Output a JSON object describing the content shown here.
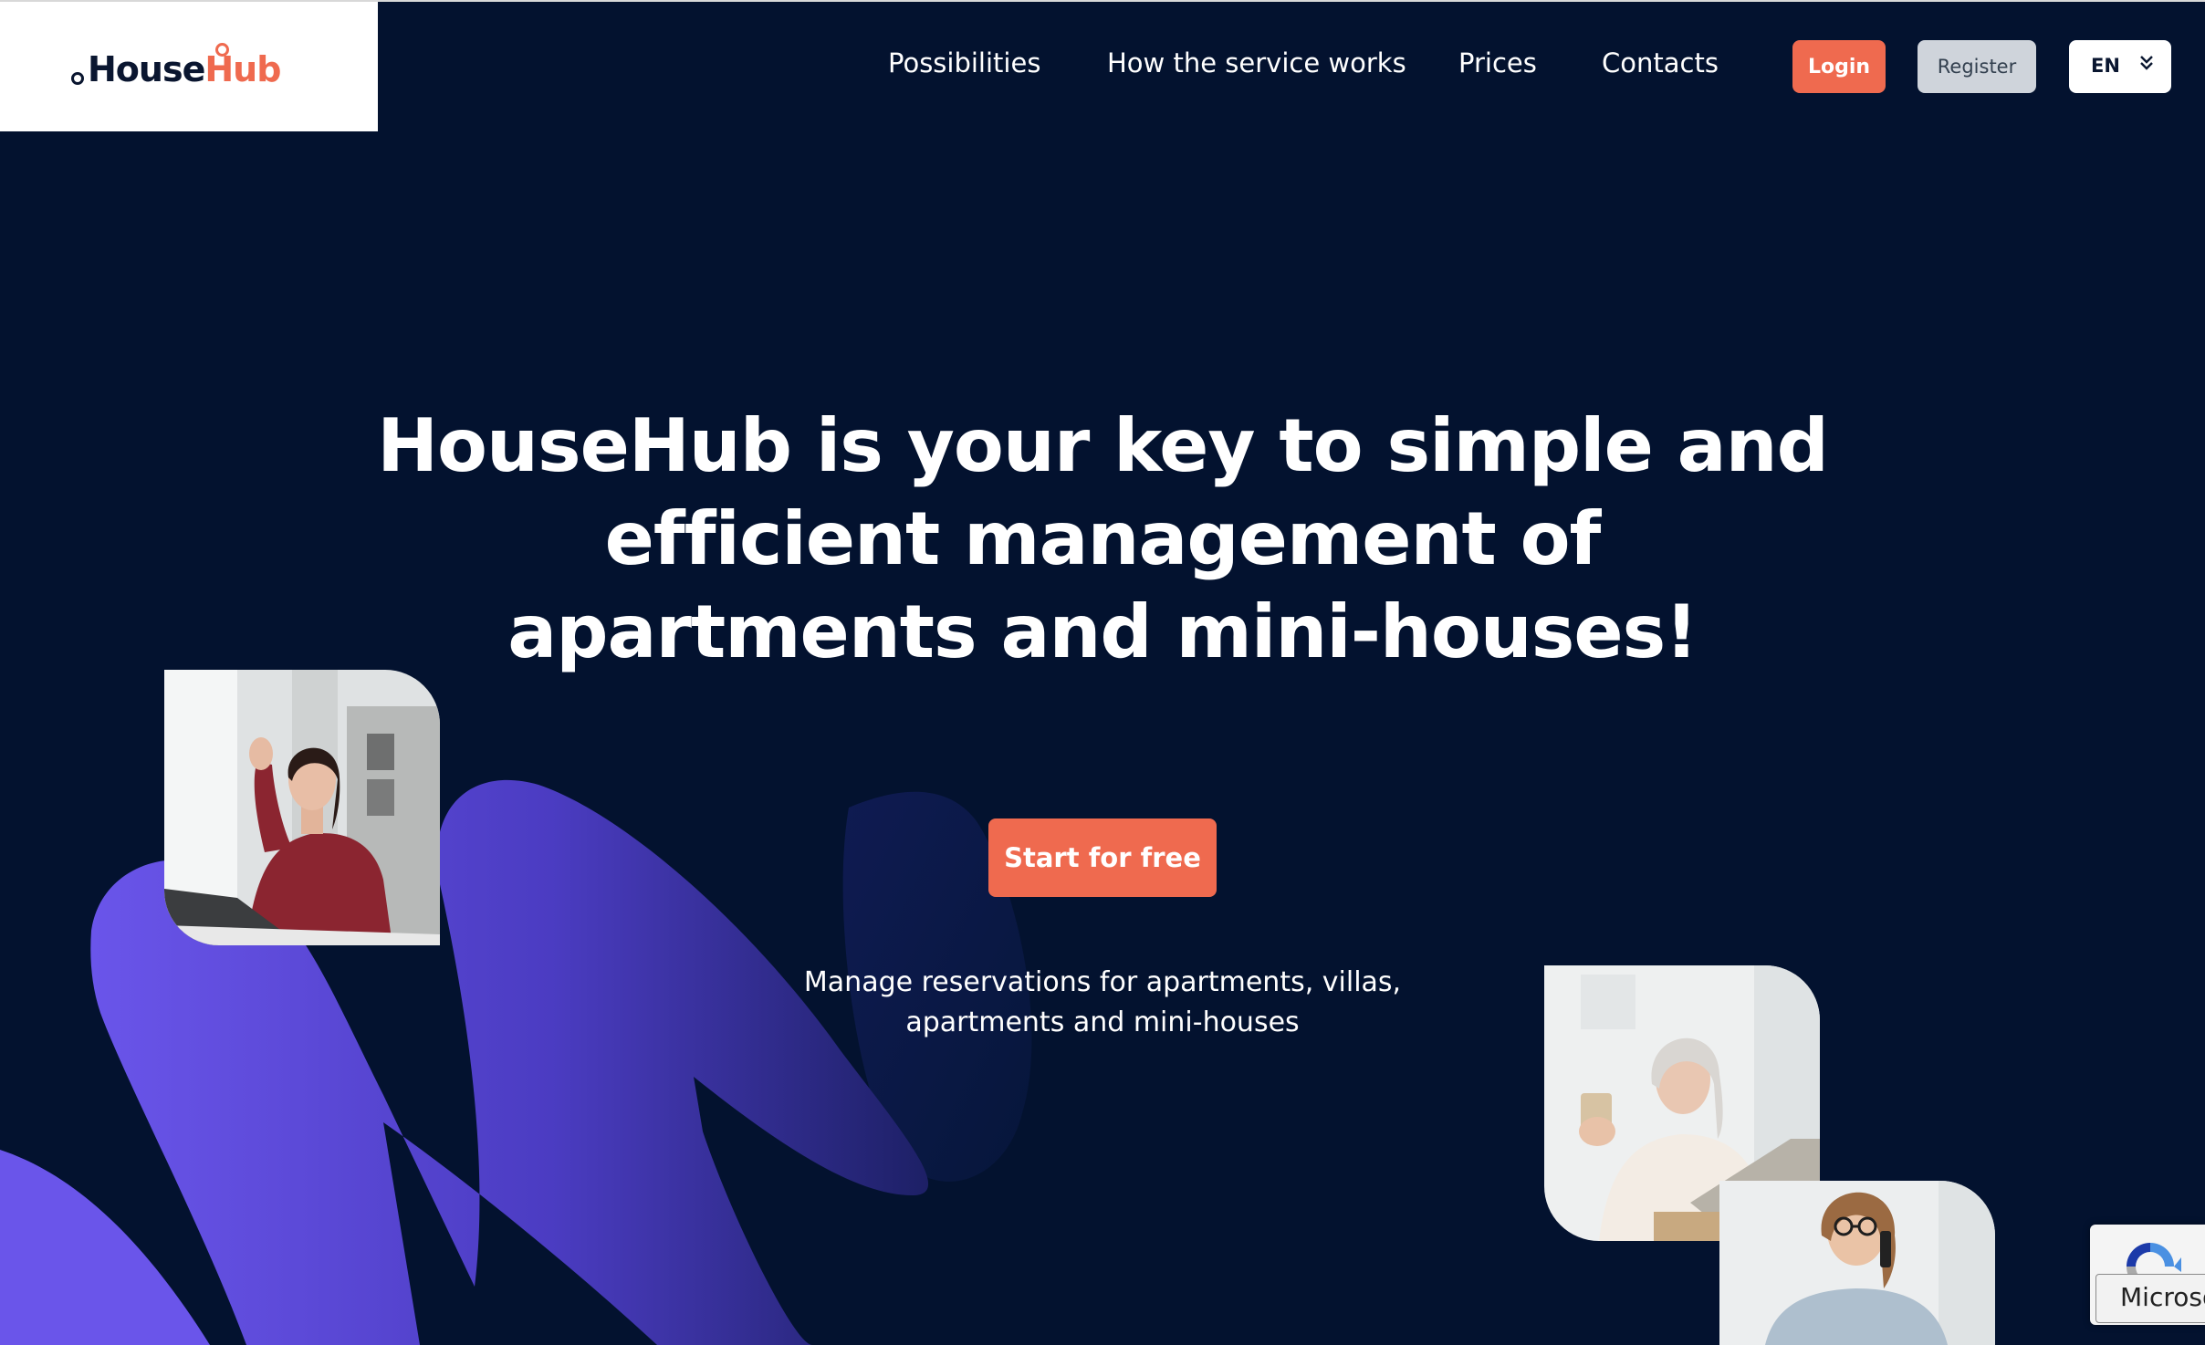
{
  "brand": {
    "name_main": "House",
    "name_accent": "Hub",
    "accent_color": "#ef6a4f",
    "background_color": "#03122f",
    "decor_color": "#6a55ea"
  },
  "nav": {
    "items": [
      {
        "label": "Possibilities"
      },
      {
        "label": "How the service works"
      },
      {
        "label": "Prices"
      },
      {
        "label": "Contacts"
      }
    ],
    "login_label": "Login",
    "register_label": "Register",
    "language": "EN"
  },
  "hero": {
    "title_line1": "HouseHub is your key to simple and",
    "title_line2": "efficient management of",
    "title_line3": "apartments and mini-houses!",
    "cta_label": "Start for free",
    "subtitle_line1": "Manage reservations for apartments, villas,",
    "subtitle_line2": "apartments and mini-houses"
  },
  "photos": [
    {
      "name": "woman-waving-at-laptop"
    },
    {
      "name": "older-woman-with-coffee-and-laptop"
    },
    {
      "name": "woman-on-phone"
    }
  ],
  "recaptcha": {
    "tooltip": "Microsoft Edge"
  }
}
